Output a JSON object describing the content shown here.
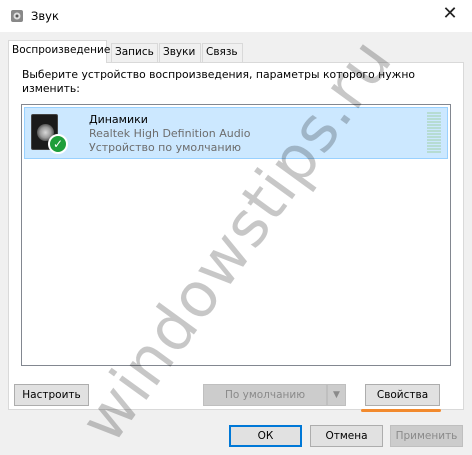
{
  "window": {
    "title": "Звук",
    "close_label": "✕"
  },
  "tabs": [
    {
      "label": "Воспроизведение",
      "active": true
    },
    {
      "label": "Запись",
      "active": false
    },
    {
      "label": "Звуки",
      "active": false
    },
    {
      "label": "Связь",
      "active": false
    }
  ],
  "panel": {
    "instruction": "Выберите устройство воспроизведения, параметры которого нужно изменить:"
  },
  "devices": [
    {
      "name": "Динамики",
      "driver": "Realtek High Definition Audio",
      "status": "Устройство по умолчанию",
      "icon": "speaker-icon",
      "badge": "✓"
    }
  ],
  "buttons": {
    "configure": "Настроить",
    "set_default": "По умолчанию",
    "default_arrow": "▼",
    "properties": "Свойства",
    "ok": "ОК",
    "cancel": "Отмена",
    "apply": "Применить"
  },
  "watermark": "windowstips.ru",
  "colors": {
    "selection": "#cce8ff",
    "highlight_underline": "#f28a2e",
    "primary_border": "#0078d7",
    "default_badge": "#1e9e3a"
  }
}
